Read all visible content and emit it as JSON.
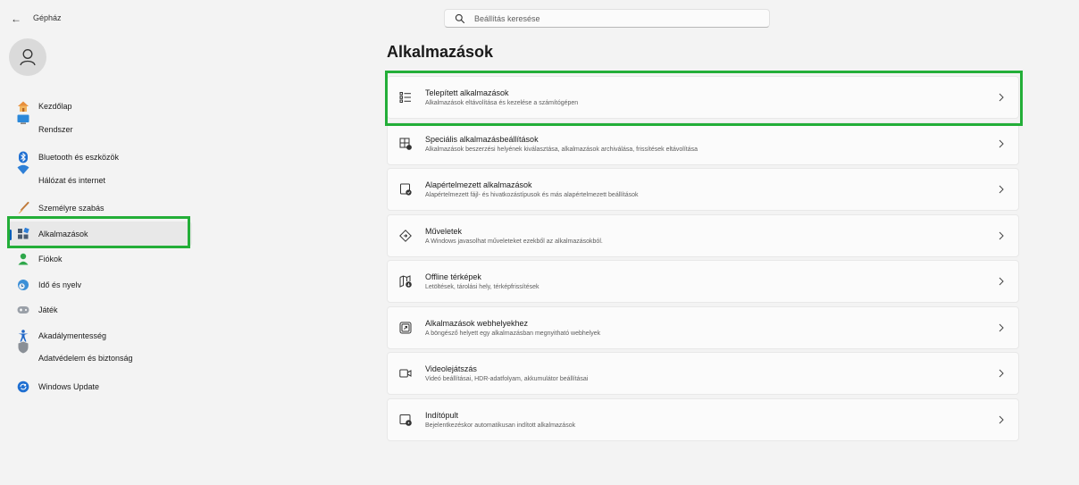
{
  "titlebar": {
    "back_glyph": "←",
    "title": "Gépház"
  },
  "search": {
    "placeholder": "Beállítás keresése",
    "icon": "search-icon"
  },
  "nav": {
    "items": [
      {
        "label": "Kezdőlap",
        "icon": "home-icon"
      },
      {
        "label": "Rendszer",
        "icon": "system-icon"
      },
      {
        "label": "Bluetooth és eszközök",
        "icon": "bluetooth-icon"
      },
      {
        "label": "Hálózat és internet",
        "icon": "network-icon"
      },
      {
        "label": "Személyre szabás",
        "icon": "brush-icon"
      },
      {
        "label": "Alkalmazások",
        "icon": "apps-icon",
        "selected": true
      },
      {
        "label": "Fiókok",
        "icon": "accounts-icon"
      },
      {
        "label": "Idő és nyelv",
        "icon": "time-language-icon"
      },
      {
        "label": "Játék",
        "icon": "gaming-icon"
      },
      {
        "label": "Akadálymentesség",
        "icon": "accessibility-icon"
      },
      {
        "label": "Adatvédelem és biztonság",
        "icon": "shield-icon"
      },
      {
        "label": "Windows Update",
        "icon": "update-icon"
      }
    ]
  },
  "main": {
    "title": "Alkalmazások",
    "cards": [
      {
        "title": "Telepített alkalmazások",
        "subtitle": "Alkalmazások eltávolítása és kezelése a számítógépen",
        "icon": "installed-apps-icon"
      },
      {
        "title": "Speciális alkalmazásbeállítások",
        "subtitle": "Alkalmazások beszerzési helyének kiválasztása, alkalmazások archiválása, frissítések eltávolítása",
        "icon": "advanced-app-settings-icon"
      },
      {
        "title": "Alapértelmezett alkalmazások",
        "subtitle": "Alapértelmezett fájl- és hivatkozástípusok és más alapértelmezett beállítások",
        "icon": "default-apps-icon"
      },
      {
        "title": "Műveletek",
        "subtitle": "A Windows javasolhat műveleteket ezekből az alkalmazásokból.",
        "icon": "actions-icon"
      },
      {
        "title": "Offline térképek",
        "subtitle": "Letöltések, tárolási hely, térképfrissítések",
        "icon": "offline-maps-icon"
      },
      {
        "title": "Alkalmazások webhelyekhez",
        "subtitle": "A böngésző helyett egy alkalmazásban megnyitható webhelyek",
        "icon": "apps-for-websites-icon"
      },
      {
        "title": "Videolejátszás",
        "subtitle": "Videó beállításai, HDR-adatfolyam, akkumulátor beállításai",
        "icon": "video-playback-icon"
      },
      {
        "title": "Indítópult",
        "subtitle": "Bejelentkezéskor automatikusan indított alkalmazások",
        "icon": "startup-icon"
      }
    ]
  },
  "colors": {
    "highlight": "#23ae38",
    "accent": "#005fb8",
    "background": "#f3f3f3",
    "card": "#fbfbfb"
  }
}
